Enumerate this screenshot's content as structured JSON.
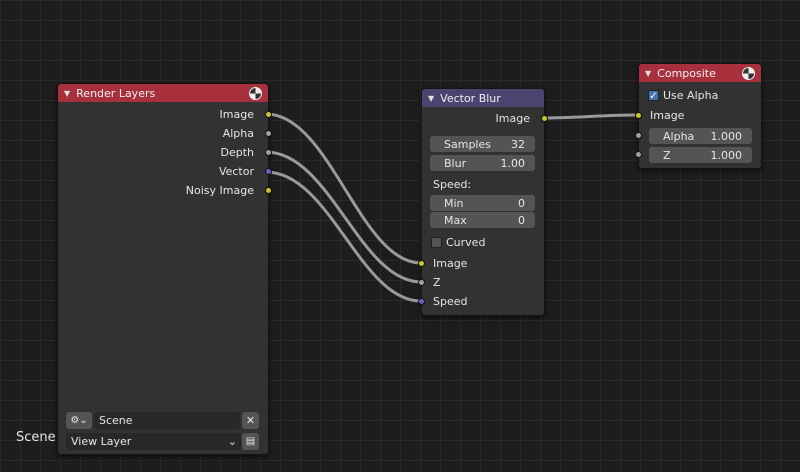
{
  "colors": {
    "node_header_red": "#a8303d",
    "node_header_purple": "#4c4470",
    "socket_color": "#c7c729",
    "socket_value": "#a1a1a1",
    "socket_vector": "#6363c7",
    "checkbox_on": "#4772b3"
  },
  "render_layers": {
    "title": "Render Layers",
    "icon": "render-icon",
    "outputs": [
      "Image",
      "Alpha",
      "Depth",
      "Vector",
      "Noisy Image"
    ],
    "scene_value": "Scene",
    "view_layer_value": "View Layer",
    "close_glyph": "✕",
    "chevron_glyph": "⌄"
  },
  "vector_blur": {
    "title": "Vector Blur",
    "output": "Image",
    "samples_label": "Samples",
    "samples_value": "32",
    "blur_label": "Blur",
    "blur_value": "1.00",
    "speed_label": "Speed:",
    "min_label": "Min",
    "min_value": "0",
    "max_label": "Max",
    "max_value": "0",
    "curved_label": "Curved",
    "inputs": [
      "Image",
      "Z",
      "Speed"
    ]
  },
  "composite": {
    "title": "Composite",
    "icon": "render-icon",
    "use_alpha_label": "Use Alpha",
    "use_alpha_checked": true,
    "inputs": [
      "Image"
    ],
    "alpha_label": "Alpha",
    "alpha_value": "1.000",
    "z_label": "Z",
    "z_value": "1.000"
  },
  "editor": {
    "scene_label": "Scene"
  }
}
